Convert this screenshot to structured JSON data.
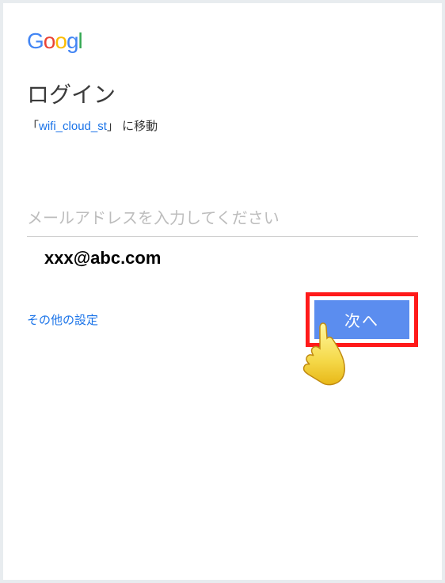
{
  "logo": {
    "g1": "G",
    "o1": "o",
    "o2": "o",
    "g2": "g",
    "l": "l"
  },
  "heading": "ログイン",
  "redirect": {
    "prefix": "「",
    "link": "wifi_cloud_st",
    "suffix": "」 に移動"
  },
  "email_field": {
    "placeholder": "メールアドレスを入力してください",
    "value": "xxx@abc.com"
  },
  "links": {
    "other_settings": "その他の設定"
  },
  "buttons": {
    "next": "次へ"
  }
}
